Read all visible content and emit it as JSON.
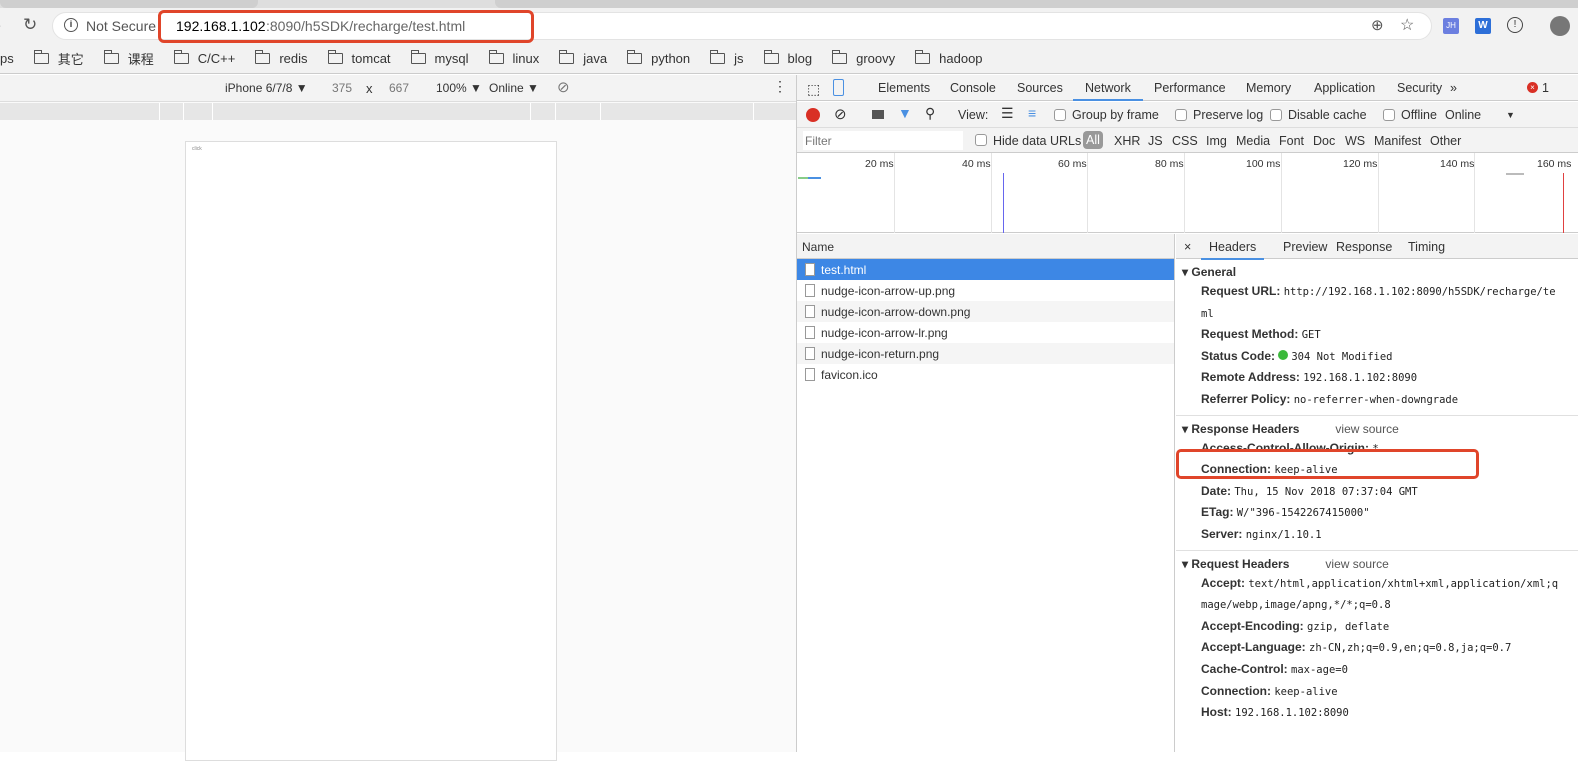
{
  "browser": {
    "security_label": "Not Secure",
    "url_host": "192.168.1.102",
    "url_rest": ":8090/h5SDK/recharge/test.html",
    "ext1": "JH",
    "ext2": "W"
  },
  "bookmarks": [
    "ps",
    "其它",
    "课程",
    "C/C++",
    "redis",
    "tomcat",
    "mysql",
    "linux",
    "java",
    "python",
    "js",
    "blog",
    "groovy",
    "hadoop"
  ],
  "device_toolbar": {
    "device": "iPhone 6/7/8 ▼",
    "width": "375",
    "x": "x",
    "height": "667",
    "zoom": "100% ▼",
    "network": "Online ▼"
  },
  "page": {
    "text": "click"
  },
  "devtools": {
    "tabs": [
      "Elements",
      "Console",
      "Sources",
      "Network",
      "Performance",
      "Memory",
      "Application",
      "Security",
      "»"
    ],
    "active_tab": "Network",
    "error_count": "1",
    "toolbar": {
      "view": "View:",
      "group_by_frame": "Group by frame",
      "preserve_log": "Preserve log",
      "disable_cache": "Disable cache",
      "offline": "Offline",
      "throttle": "Online"
    },
    "filter": {
      "placeholder": "Filter",
      "hide_data_urls": "Hide data URLs",
      "types": [
        "All",
        "XHR",
        "JS",
        "CSS",
        "Img",
        "Media",
        "Font",
        "Doc",
        "WS",
        "Manifest",
        "Other"
      ]
    },
    "timeline_ticks": [
      "20 ms",
      "40 ms",
      "60 ms",
      "80 ms",
      "100 ms",
      "120 ms",
      "140 ms",
      "160 ms"
    ],
    "list": {
      "header": "Name",
      "items": [
        "test.html",
        "nudge-icon-arrow-up.png",
        "nudge-icon-arrow-down.png",
        "nudge-icon-arrow-lr.png",
        "nudge-icon-return.png",
        "favicon.ico"
      ]
    },
    "detail": {
      "tabs": [
        "Headers",
        "Preview",
        "Response",
        "Timing"
      ],
      "general": {
        "title": "General",
        "rows": [
          {
            "k": "Request URL:",
            "v": "http://192.168.1.102:8090/h5SDK/recharge/te"
          },
          {
            "k": "",
            "v": "ml"
          },
          {
            "k": "Request Method:",
            "v": "GET"
          },
          {
            "k": "Status Code:",
            "v": "304 Not Modified"
          },
          {
            "k": "Remote Address:",
            "v": "192.168.1.102:8090"
          },
          {
            "k": "Referrer Policy:",
            "v": "no-referrer-when-downgrade"
          }
        ]
      },
      "response": {
        "title": "Response Headers",
        "view_source": "view source",
        "rows": [
          {
            "k": "Access-Control-Allow-Origin:",
            "v": "*"
          },
          {
            "k": "Connection:",
            "v": "keep-alive"
          },
          {
            "k": "Date:",
            "v": "Thu, 15 Nov 2018 07:37:04 GMT"
          },
          {
            "k": "ETag:",
            "v": "W/\"396-1542267415000\""
          },
          {
            "k": "Server:",
            "v": "nginx/1.10.1"
          }
        ]
      },
      "request": {
        "title": "Request Headers",
        "view_source": "view source",
        "rows": [
          {
            "k": "Accept:",
            "v": "text/html,application/xhtml+xml,application/xml;q"
          },
          {
            "k": "",
            "v": "mage/webp,image/apng,*/*;q=0.8"
          },
          {
            "k": "Accept-Encoding:",
            "v": "gzip, deflate"
          },
          {
            "k": "Accept-Language:",
            "v": "zh-CN,zh;q=0.9,en;q=0.8,ja;q=0.7"
          },
          {
            "k": "Cache-Control:",
            "v": "max-age=0"
          },
          {
            "k": "Connection:",
            "v": "keep-alive"
          },
          {
            "k": "Host:",
            "v": "192.168.1.102:8090"
          }
        ]
      }
    }
  },
  "colors": {
    "accent": "#4a90e2",
    "highlight": "#e0452a",
    "selected_row": "#3d87e5"
  }
}
